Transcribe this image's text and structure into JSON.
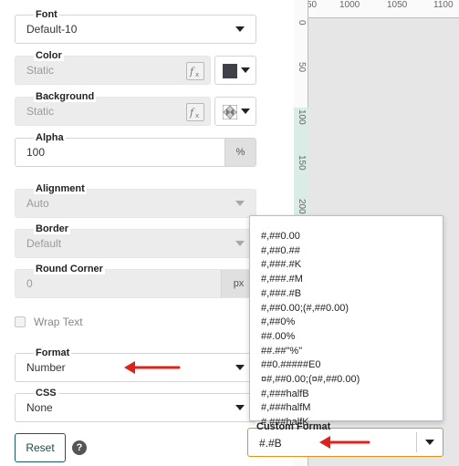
{
  "panel": {
    "font": {
      "label": "Font",
      "value": "Default-10"
    },
    "color": {
      "label": "Color",
      "value": "Static",
      "swatch": "#3e4248"
    },
    "background": {
      "label": "Background",
      "value": "Static"
    },
    "alpha": {
      "label": "Alpha",
      "value": "100",
      "unit": "%"
    },
    "alignment": {
      "label": "Alignment",
      "value": "Auto"
    },
    "border": {
      "label": "Border",
      "value": "Default"
    },
    "round_corner": {
      "label": "Round Corner",
      "value": "0",
      "unit": "px"
    },
    "wrap_text": {
      "label": "Wrap Text",
      "checked": false
    },
    "format": {
      "label": "Format",
      "value": "Number"
    },
    "css": {
      "label": "CSS",
      "value": "None"
    },
    "reset_label": "Reset",
    "help_glyph": "?"
  },
  "ruler": {
    "top_ticks": [
      "50",
      "1000",
      "1050",
      "1100"
    ],
    "left_ticks": [
      "0",
      "50",
      "100",
      "150",
      "200"
    ]
  },
  "format_dropdown": {
    "options": [
      "#,##0.00",
      "#,##0.##",
      "#,###.#K",
      "#,###.#M",
      "#,###.#B",
      "#,##0.00;(#,##0.00)",
      "#,##0%",
      "##.00%",
      "##.##\"%\"",
      "##0.#####E0",
      "¤#,##0.00;(¤#,##0.00)",
      "#,###halfB",
      "#,###halfM",
      "#,###halfK"
    ],
    "custom_format_label": "Custom Format",
    "custom_format_value": "#.#B"
  },
  "colors": {
    "annotation_arrow": "#e0201b",
    "focus_border": "#e8901e",
    "reset_border": "#1a5a5a"
  }
}
